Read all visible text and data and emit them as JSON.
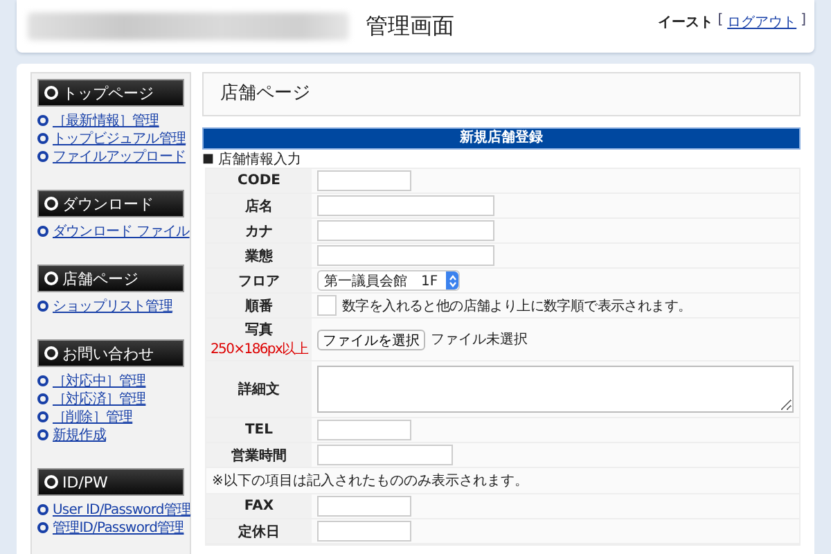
{
  "header": {
    "title": "管理画面",
    "user": "イースト",
    "bracket_open": "[",
    "logout": "ログアウト",
    "bracket_close": "]"
  },
  "sidebar": {
    "sections": [
      {
        "title": "トップページ",
        "links": [
          "［最新情報］管理",
          "トップビジュアル管理",
          "ファイルアップロード"
        ]
      },
      {
        "title": "ダウンロード",
        "links": [
          "ダウンロード ファイル"
        ]
      },
      {
        "title": "店舗ページ",
        "links": [
          "ショップリスト管理"
        ]
      },
      {
        "title": "お問い合わせ",
        "links": [
          "［対応中］管理",
          "［対応済］管理",
          "［削除］管理",
          "新規作成"
        ]
      },
      {
        "title": "ID/PW",
        "links": [
          "User ID/Password管理",
          "管理ID/Password管理"
        ]
      }
    ]
  },
  "page_title": "店舗ページ",
  "form": {
    "title": "新規店舗登録",
    "bullet": "■",
    "section": "店舗情報入力",
    "rows": [
      {
        "kind": "short",
        "label": "CODE"
      },
      {
        "kind": "long",
        "label": "店名"
      },
      {
        "kind": "long",
        "label": "カナ"
      },
      {
        "kind": "long",
        "label": "業態"
      },
      {
        "kind": "select",
        "label": "フロア",
        "value": "第一議員会館　1F"
      },
      {
        "kind": "order",
        "label": "順番",
        "hint": "数字を入れると他の店舗より上に数字順で表示されます。"
      },
      {
        "kind": "file",
        "label": "写真",
        "note": "250×186px以上",
        "button": "ファイルを選択",
        "status": "ファイル未選択"
      },
      {
        "kind": "textarea",
        "label": "詳細文"
      },
      {
        "kind": "short",
        "label": "TEL"
      },
      {
        "kind": "medium",
        "label": "営業時間"
      },
      {
        "kind": "note",
        "text": "※以下の項目は記入されたもののみ表示されます。"
      },
      {
        "kind": "short",
        "label": "FAX"
      },
      {
        "kind": "short",
        "label": "定休日"
      }
    ]
  }
}
